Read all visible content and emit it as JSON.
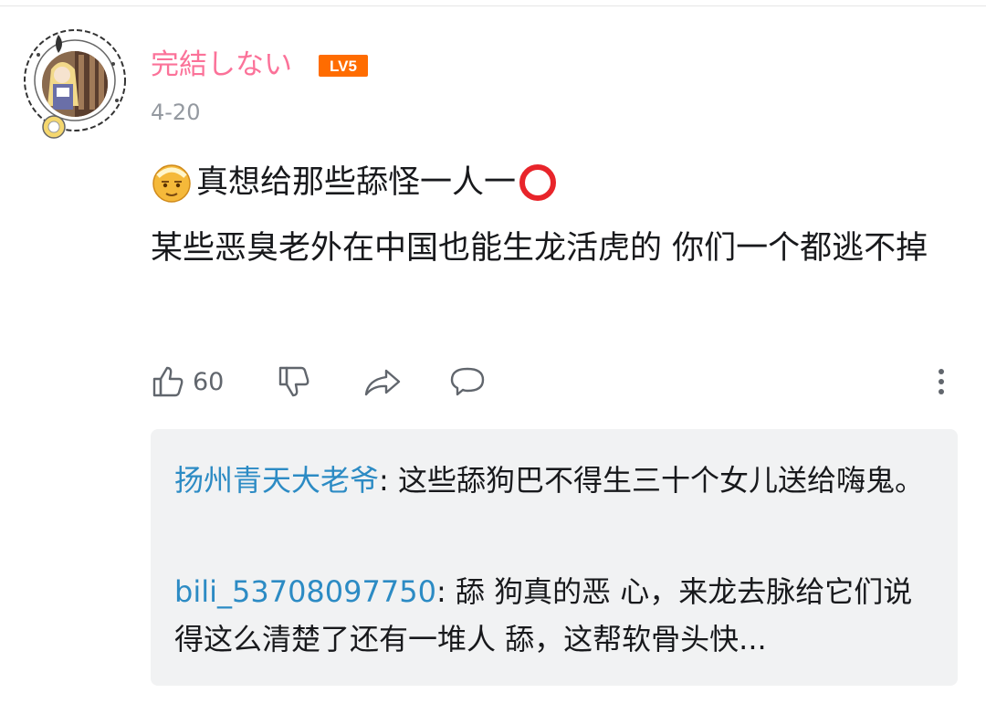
{
  "comment": {
    "username": "完結しない",
    "level": "LV5",
    "date": "4-20",
    "line1_text": "真想给那些舔怪一人一",
    "body": "某些恶臭老外在中国也能生龙活虎的 你们一个都逃不掉",
    "likes": "60"
  },
  "replies": [
    {
      "name": "扬州青天大老爷",
      "separator": ": ",
      "text": "这些舔狗巴不得生三十个女儿送给嗨鬼。"
    },
    {
      "name": "bili_53708097750",
      "separator": ": ",
      "text": "舔 狗真的恶 心，来龙去脉给它们说得这么清楚了还有一堆人 舔，这帮软骨头快..."
    }
  ],
  "icons": {
    "emoji": "elderly-face-emoji-icon",
    "circle": "red-circle-emoji-icon",
    "like": "thumbs-up-icon",
    "dislike": "thumbs-down-icon",
    "share": "share-icon",
    "reply": "comment-bubble-icon",
    "more": "more-vertical-icon"
  },
  "colors": {
    "username": "#fb7299",
    "level_badge": "#ff6c00",
    "reply_name": "#2c8bc4",
    "meta_text": "#9499a0",
    "reply_bg": "#f1f2f3"
  }
}
